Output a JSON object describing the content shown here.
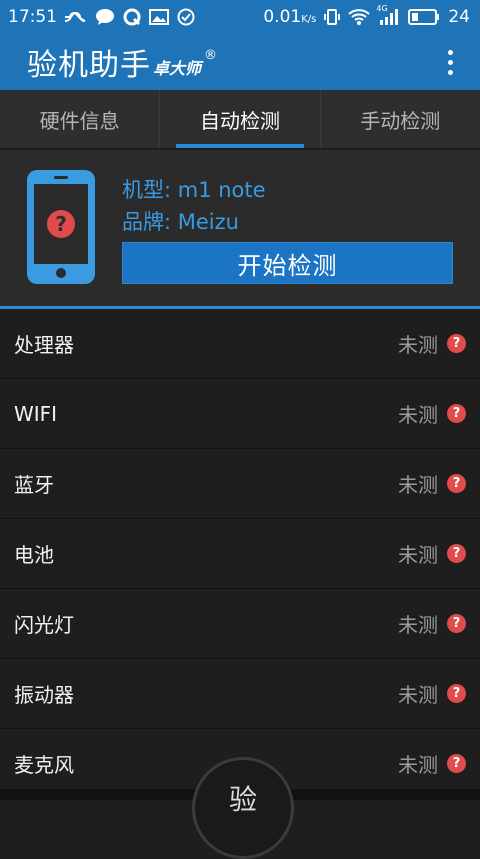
{
  "status_bar": {
    "time": "17:51",
    "speed": "0.01",
    "speed_unit": "K/s",
    "network": "4G",
    "battery": "24"
  },
  "app_bar": {
    "title": "验机助手",
    "subtitle": "卓大师",
    "registered": "®"
  },
  "tabs": [
    {
      "label": "硬件信息",
      "active": false
    },
    {
      "label": "自动检测",
      "active": true
    },
    {
      "label": "手动检测",
      "active": false
    }
  ],
  "device": {
    "model": "机型: m1 note",
    "brand": "品牌: Meizu",
    "start_button": "开始检测"
  },
  "items": [
    {
      "name": "处理器",
      "status": "未测"
    },
    {
      "name": "WIFI",
      "status": "未测"
    },
    {
      "name": "蓝牙",
      "status": "未测"
    },
    {
      "name": "电池",
      "status": "未测"
    },
    {
      "name": "闪光灯",
      "status": "未测"
    },
    {
      "name": "振动器",
      "status": "未测"
    },
    {
      "name": "麦克风",
      "status": "未测"
    }
  ],
  "bottom_bar": {
    "center_label": "验"
  },
  "colors": {
    "primary": "#1f73b7",
    "accent": "#2a8ad4",
    "warning": "#e04b4b",
    "background": "#1e1e1e"
  }
}
